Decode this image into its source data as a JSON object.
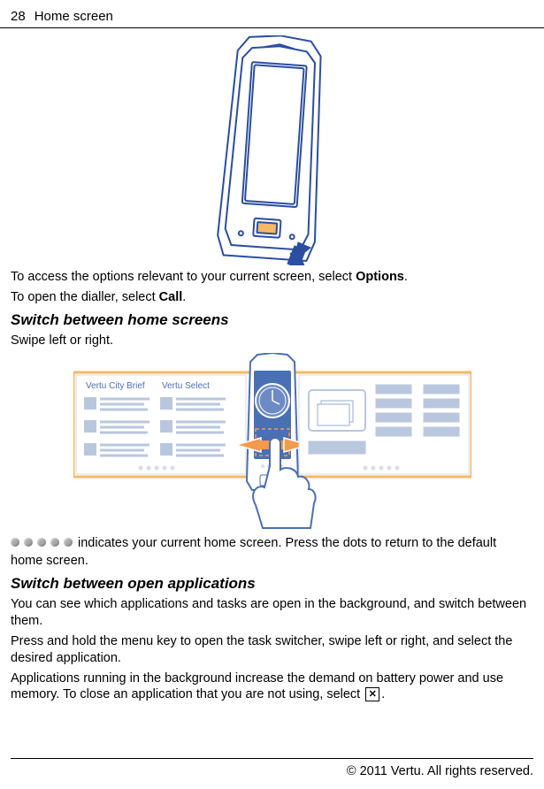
{
  "header": {
    "page_number": "28",
    "section_title": "Home screen"
  },
  "illustration1": {
    "name": "phone-front-illustration"
  },
  "para_options_prefix": "To access the options relevant to your current screen, select ",
  "para_options_bold": "Options",
  "para_options_suffix": ".",
  "para_dialler_prefix": "To open the dialler, select ",
  "para_dialler_bold": "Call",
  "para_dialler_suffix": ".",
  "subhead_switch_home": "Switch between home screens",
  "para_swipe": "Swipe left or right.",
  "swipe_illus": {
    "widget1_title": "Vertu City Brief",
    "widget2_title": "Vertu Select"
  },
  "indicator_text_1": " indicates your current home screen. Press the dots to return to the default",
  "indicator_text_2": "home screen.",
  "subhead_switch_apps": "Switch between open applications",
  "para_apps_1": "You can see which applications and tasks are open in the background, and switch between them.",
  "para_apps_2": "Press and hold the menu key to open the task switcher, swipe left or right, and select the desired application.",
  "para_apps_3_prefix": "Applications running in the background increase the demand on battery power and use memory. To close an application that you are not using, select ",
  "para_apps_3_suffix": ".",
  "close_icon_glyph": "✕",
  "footer": "© 2011 Vertu. All rights reserved."
}
